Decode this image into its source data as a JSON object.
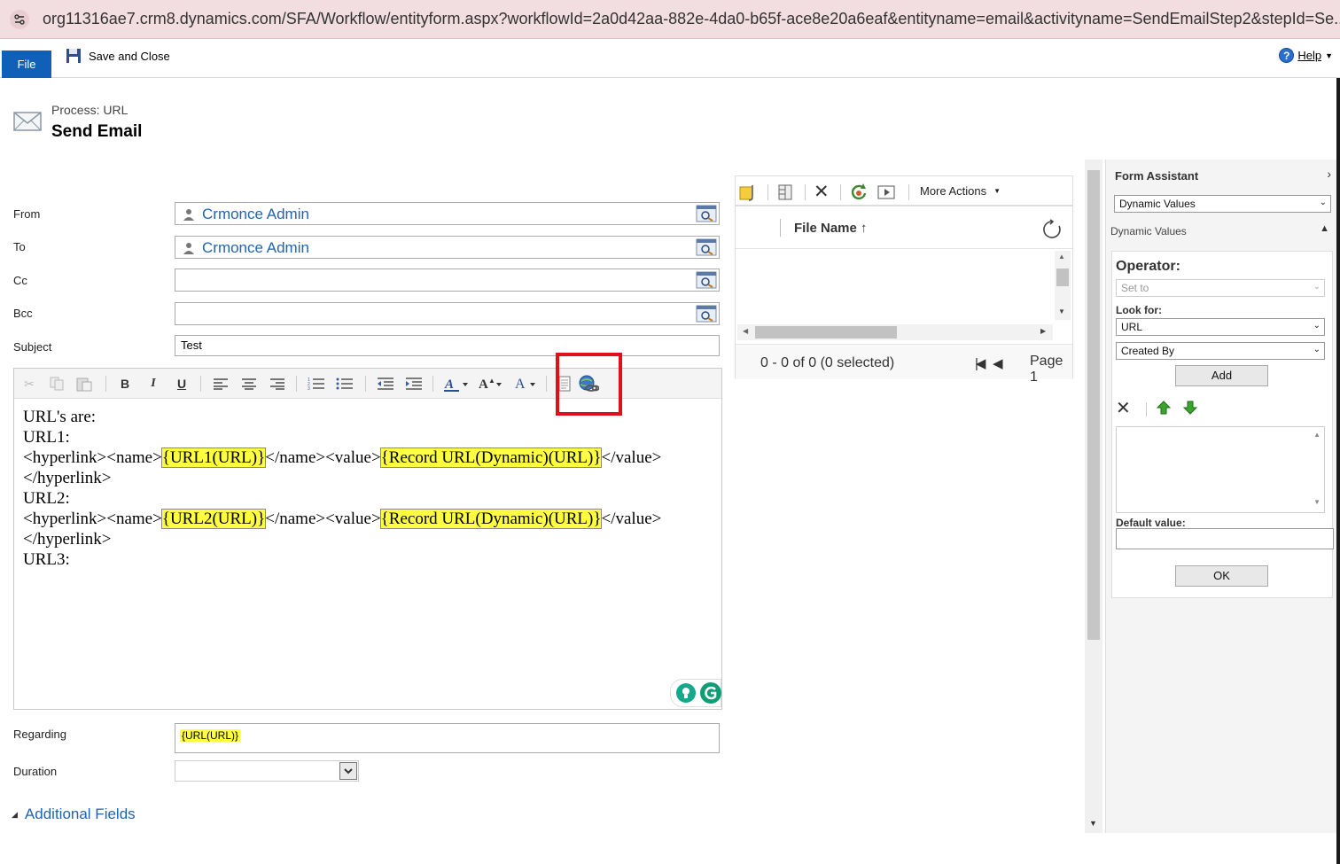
{
  "browser": {
    "url": "org11316ae7.crm8.dynamics.com/SFA/Workflow/entityform.aspx?workflowId=2a0d42aa-882e-4da0-b65f-ace8e20a6eaf&entityname=email&activityname=SendEmailStep2&stepId=Se..."
  },
  "ribbon": {
    "file": "File",
    "save_close": "Save and Close",
    "help": "Help"
  },
  "header": {
    "process": "Process: URL",
    "title": "Send Email"
  },
  "form": {
    "from_label": "From",
    "from_value": "Crmonce Admin",
    "to_label": "To",
    "to_value": "Crmonce Admin",
    "cc_label": "Cc",
    "bcc_label": "Bcc",
    "subject_label": "Subject",
    "subject_value": "Test",
    "regarding_label": "Regarding",
    "regarding_value": "{URL(URL)}",
    "duration_label": "Duration",
    "additional_fields": "Additional Fields"
  },
  "editor": {
    "lines": {
      "l1": "URL's are:",
      "l2": "URL1:",
      "l3a": "<hyperlink><name>",
      "l3b": "{URL1(URL)}",
      "l3c": "</name><value>",
      "l3d": "{Record URL(Dynamic)(URL)}",
      "l3e": "</value>",
      "l4": "</hyperlink>",
      "l5": "URL2:",
      "l6a": "<hyperlink><name>",
      "l6b": "{URL2(URL)}",
      "l6c": "</name><value>",
      "l6d": "{Record URL(Dynamic)(URL)}",
      "l6e": "</value>",
      "l7": "</hyperlink>",
      "l8": "URL3:"
    },
    "toolbar": {
      "bold": "B",
      "italic": "I",
      "underline": "U"
    }
  },
  "attachments": {
    "more_actions": "More Actions",
    "column": "File Name",
    "count": "0 - 0 of 0 (0 selected)",
    "page": "Page 1"
  },
  "assistant": {
    "title": "Form Assistant",
    "mode": "Dynamic Values",
    "section": "Dynamic Values",
    "operator_label": "Operator:",
    "operator_value": "Set to",
    "lookfor_label": "Look for:",
    "lookfor_entity": "URL",
    "lookfor_field": "Created By",
    "add": "Add",
    "default_label": "Default value:",
    "ok": "OK"
  },
  "colors": {
    "accent": "#1160b7",
    "link": "#1f64b4",
    "highlight": "#ffff40",
    "callout": "#e0101a"
  }
}
